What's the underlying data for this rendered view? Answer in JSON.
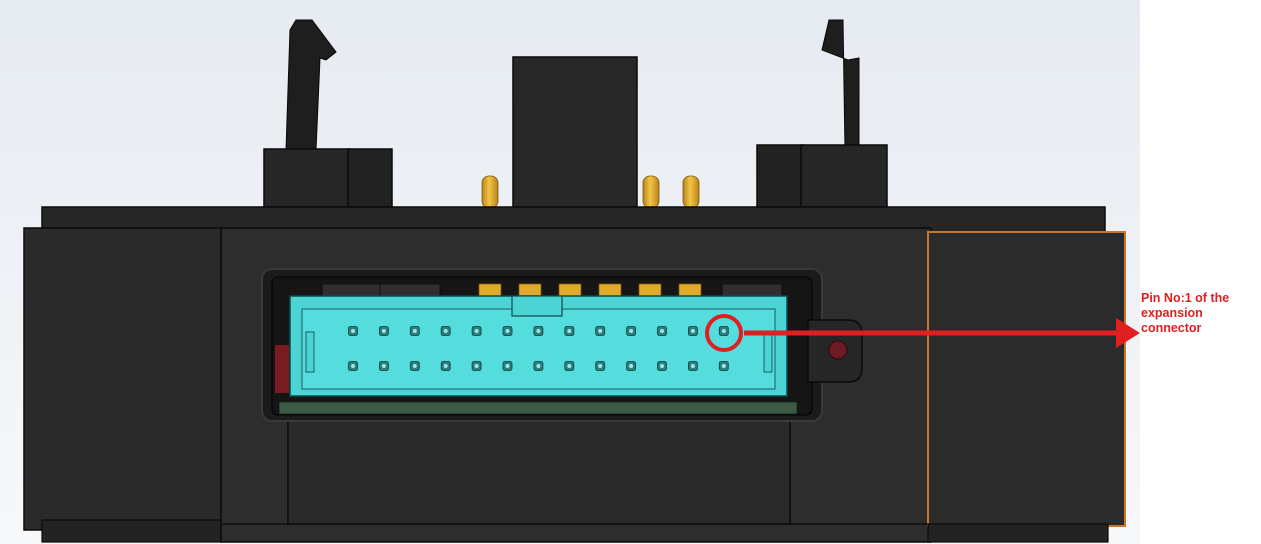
{
  "annotation": {
    "lines": [
      "Pin No:1 of the",
      "expansion",
      "connector"
    ]
  },
  "colors": {
    "body": "#2b2b2b",
    "body_edge": "#0d0d0d",
    "connector": "#4cd3d3",
    "pin_gold": "#e2aa2a",
    "callout": "#e02020",
    "highlight_frame": "#c8772a"
  },
  "connector": {
    "rows": 2,
    "pins_per_row": 13,
    "highlighted_pin": 1
  }
}
